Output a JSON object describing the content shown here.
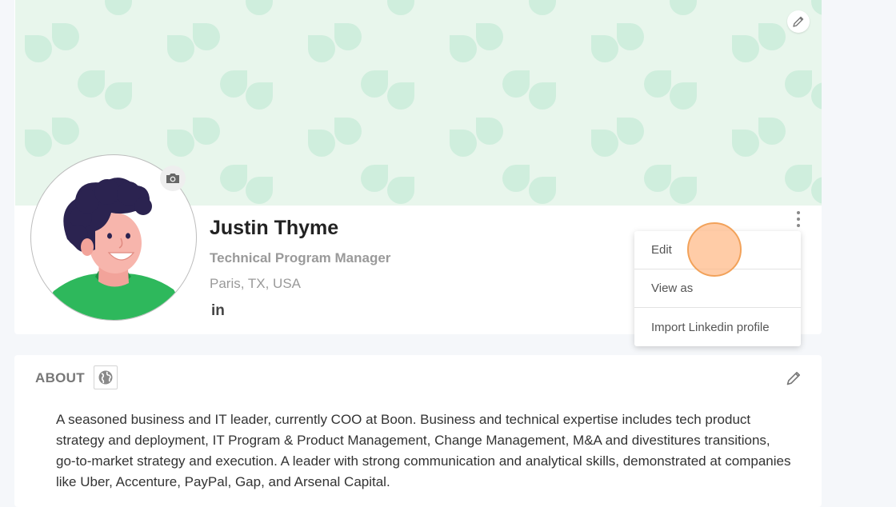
{
  "profile": {
    "name": "Justin Thyme",
    "job_title": "Technical Program Manager",
    "location": "Paris, TX, USA",
    "linkedin_label": "in"
  },
  "menu": {
    "items": [
      {
        "label": "Edit"
      },
      {
        "label": "View as"
      },
      {
        "label": "Import Linkedin profile"
      }
    ]
  },
  "about": {
    "title": "ABOUT",
    "text": "A seasoned business and IT leader, currently COO at Boon. Business and technical expertise includes tech product strategy and deployment, IT Program & Product Management, Change Management, M&A and divestitures transitions, go-to-market strategy and execution. A leader with strong communication and analytical skills, demonstrated at companies like Uber, Accenture, PayPal, Gap, and Arsenal Capital."
  },
  "icons": {
    "cover_edit": "pencil-icon",
    "camera": "camera-icon",
    "more": "kebab-icon",
    "visibility": "globe-icon",
    "about_edit": "pencil-icon"
  },
  "colors": {
    "cover_bg": "#e8f6ec",
    "cover_pattern": "#cfeedd",
    "accent_orange": "#f2a25a",
    "shirt_green": "#2eb85c",
    "hair": "#2b2350"
  }
}
